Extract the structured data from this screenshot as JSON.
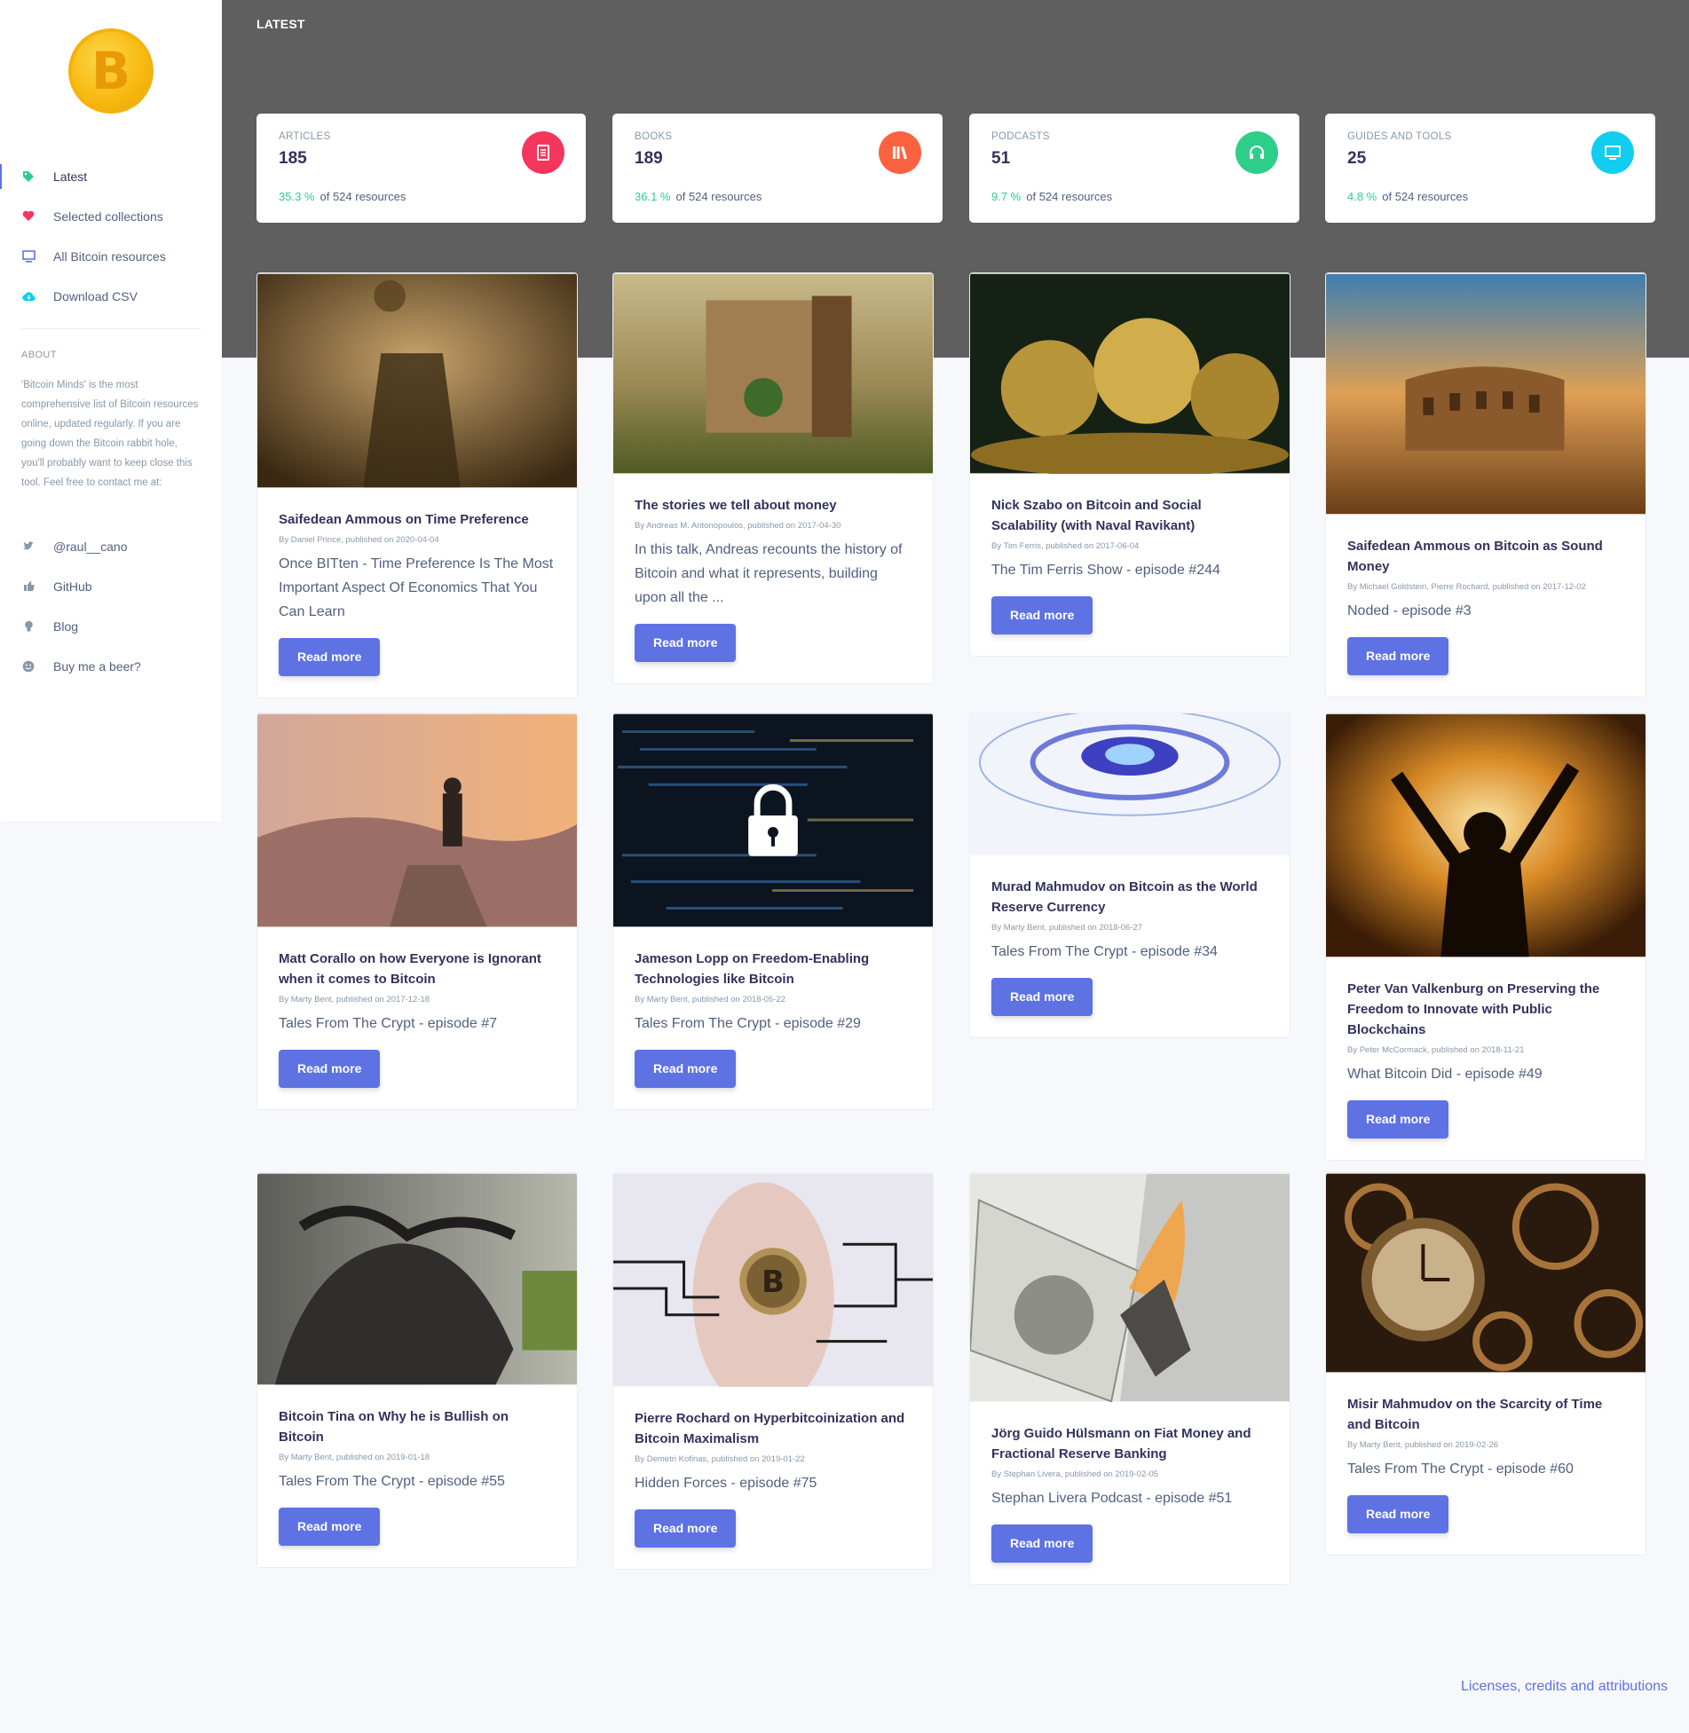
{
  "app": {
    "page_title": "LATEST"
  },
  "sidebar": {
    "logo_glyph": "B",
    "nav": [
      {
        "label": "Latest",
        "icon": "tag-icon",
        "color": "#2dce89"
      },
      {
        "label": "Selected collections",
        "icon": "heart-icon",
        "color": "#f5365c"
      },
      {
        "label": "All Bitcoin resources",
        "icon": "monitor-icon",
        "color": "#5e72e4"
      },
      {
        "label": "Download CSV",
        "icon": "cloud-download-icon",
        "color": "#11cdef"
      }
    ],
    "about_heading": "ABOUT",
    "about_text": "'Bitcoin Minds' is the most comprehensive list of Bitcoin resources online, updated regularly. If you are going down the Bitcoin rabbit hole, you'll probably want to keep close this tool. Feel free to contact me at:",
    "links": [
      {
        "label": "@raul__cano",
        "icon": "bird-icon"
      },
      {
        "label": "GitHub",
        "icon": "thumbs-up-icon"
      },
      {
        "label": "Blog",
        "icon": "bulb-icon"
      },
      {
        "label": "Buy me a beer?",
        "icon": "smile-icon"
      }
    ]
  },
  "stats": [
    {
      "title": "ARTICLES",
      "value": "185",
      "pct": "35.3 %",
      "suffix": "of 524 resources",
      "color": "#f5365c",
      "icon": "document-icon"
    },
    {
      "title": "BOOKS",
      "value": "189",
      "pct": "36.1 %",
      "suffix": "of 524 resources",
      "color": "#fb6340",
      "icon": "books-icon"
    },
    {
      "title": "PODCASTS",
      "value": "51",
      "pct": "9.7 %",
      "suffix": "of 524 resources",
      "color": "#2dce89",
      "icon": "headphones-icon"
    },
    {
      "title": "GUIDES AND TOOLS",
      "value": "25",
      "pct": "4.8 %",
      "suffix": "of 524 resources",
      "color": "#11cdef",
      "icon": "monitor-icon"
    }
  ],
  "cards": [
    {
      "title": "Saifedean Ammous on Time Preference",
      "meta": "By Daniel Prince, published on 2020-04-04",
      "text": "Once BITten - Time Preference Is The Most Important Aspect Of Economics That You Can Learn",
      "button": "Read more"
    },
    {
      "title": "The stories we tell about money",
      "meta": "By Andreas M. Antonopoulos, published on 2017-04-30",
      "text": "In this talk, Andreas recounts the history of Bitcoin and what it represents, building upon all the ...",
      "button": "Read more"
    },
    {
      "title": "Nick Szabo on Bitcoin and Social Scalability (with Naval Ravikant)",
      "meta": "By Tim Ferris, published on 2017-06-04",
      "text": "The Tim Ferris Show - episode #244",
      "button": "Read more"
    },
    {
      "title": "Saifedean Ammous on Bitcoin as Sound Money",
      "meta": "By Michael Goldstein, Pierre Rochard, published on 2017-12-02",
      "text": "Noded - episode #3",
      "button": "Read more"
    },
    {
      "title": "Matt Corallo on how Everyone is Ignorant when it comes to Bitcoin",
      "meta": "By Marty Bent, published on 2017-12-18",
      "text": "Tales From The Crypt - episode #7",
      "button": "Read more"
    },
    {
      "title": "Jameson Lopp on Freedom-Enabling Technologies like Bitcoin",
      "meta": "By Marty Bent, published on 2018-05-22",
      "text": "Tales From The Crypt - episode #29",
      "button": "Read more"
    },
    {
      "title": "Murad Mahmudov on Bitcoin as the World Reserve Currency",
      "meta": "By Marty Bent, published on 2018-06-27",
      "text": "Tales From The Crypt - episode #34",
      "button": "Read more"
    },
    {
      "title": "Peter Van Valkenburg on Preserving the Freedom to Innovate with Public Blockchains",
      "meta": "By Peter McCormack, published on 2018-11-21",
      "text": "What Bitcoin Did - episode #49",
      "button": "Read more"
    },
    {
      "title": "Bitcoin Tina on Why he is Bullish on Bitcoin",
      "meta": "By Marty Bent, published on 2019-01-18",
      "text": "Tales From The Crypt - episode #55",
      "button": "Read more"
    },
    {
      "title": "Pierre Rochard on Hyperbitcoinization and Bitcoin Maximalism",
      "meta": "By Demetri Kofinas, published on 2019-01-22",
      "text": "Hidden Forces - episode #75",
      "button": "Read more"
    },
    {
      "title": "Jörg Guido Hülsmann on Fiat Money and Fractional Reserve Banking",
      "meta": "By Stephan Livera, published on 2019-02-05",
      "text": "Stephan Livera Podcast - episode #51",
      "button": "Read more"
    },
    {
      "title": "Misir Mahmudov on the Scarcity of Time and Bitcoin",
      "meta": "By Marty Bent, published on 2019-02-26",
      "text": "Tales From The Crypt - episode #60",
      "button": "Read more"
    }
  ],
  "footer": {
    "link": "Licenses, credits and attributions"
  }
}
